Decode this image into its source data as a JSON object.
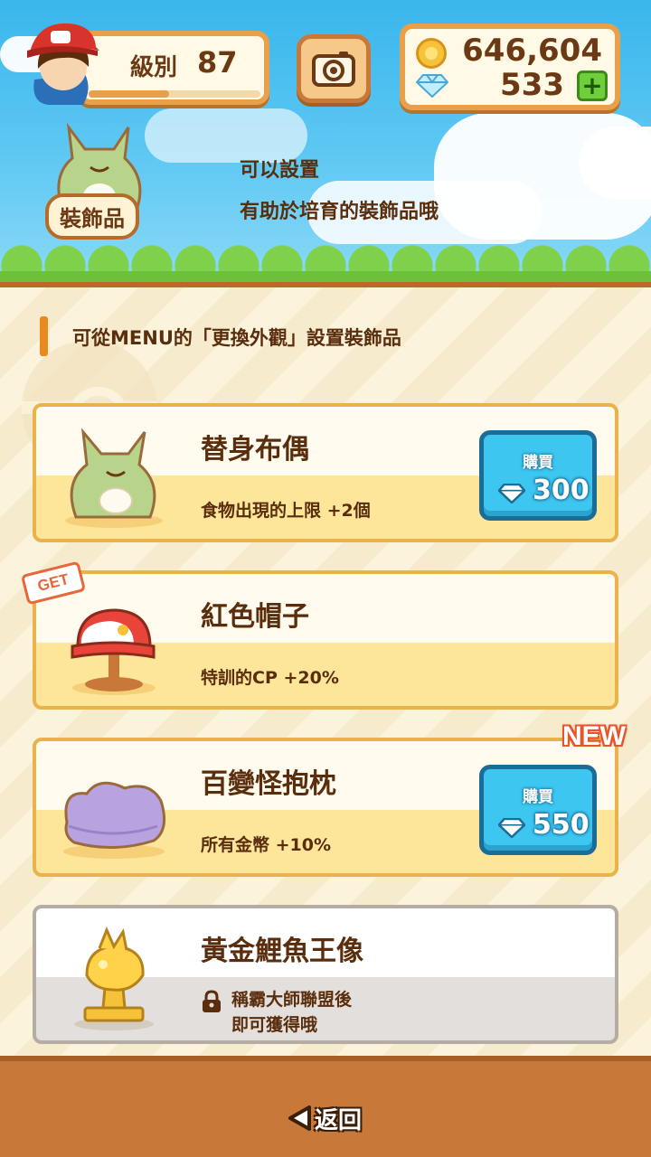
{
  "header": {
    "level_label": "級別",
    "level_value": "87",
    "level_progress": 0.47,
    "coins": "646,604",
    "gems": "533",
    "plus_label": "+"
  },
  "decoration_banner": {
    "tag": "裝飾品",
    "line1": "可以設置",
    "line2": "有助於培育的裝飾品哦"
  },
  "hint": "可從MENU的「更換外觀」設置裝飾品",
  "items": [
    {
      "title": "替身布偶",
      "effect": "食物出現的上限 +2個",
      "buy_label": "購買",
      "price": "300",
      "image_icon": "substitute-doll-icon"
    },
    {
      "title": "紅色帽子",
      "effect": "特訓的CP +20%",
      "badge": "GET",
      "image_icon": "red-cap-icon"
    },
    {
      "title": "百變怪抱枕",
      "effect": "所有金幣 +10%",
      "buy_label": "購買",
      "price": "550",
      "badge": "NEW",
      "image_icon": "ditto-pillow-icon"
    },
    {
      "title": "黃金鯉魚王像",
      "lock_line1": "稱霸大師聯盟後",
      "lock_line2": "即可獲得哦",
      "image_icon": "gold-magikarp-statue-icon"
    }
  ],
  "footer": {
    "back_label": "返回"
  },
  "colors": {
    "sky": "#39b6ec",
    "card_border": "#eab24a",
    "buy_button": "#3cc6f0",
    "footer": "#c8793a",
    "accent_orange": "#e88a1e"
  }
}
